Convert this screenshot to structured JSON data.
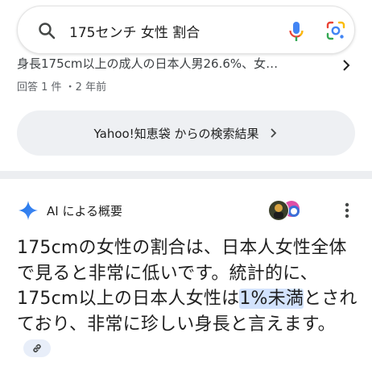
{
  "search": {
    "query": "175センチ 女性 割合"
  },
  "previous_result": {
    "clipped_snippet": "身長175cm以上の成人の日本人男26.6%、女…",
    "meta": "回答 1 件 ・2 年前"
  },
  "more_results": {
    "label": "Yahoo!知恵袋 からの検索結果"
  },
  "ai_overview": {
    "title": "AI による概要",
    "answer_before": "175cmの女性の割合は、日本人女性全体で見ると非常に低いです。統計的に、175cm以上の日本人女性は",
    "answer_highlight": "1%未満",
    "answer_after": "とされており、非常に珍しい身長と言えます。"
  },
  "colors": {
    "highlight": "#d3e3fd",
    "chip_bg": "#eef0f3",
    "google_blue": "#4285f4",
    "google_red": "#ea4335",
    "google_yellow": "#fbbc04",
    "google_green": "#34a853"
  },
  "icons": [
    "search-icon",
    "mic-icon",
    "google-lens-icon",
    "chevron-right-icon",
    "gemini-sparkle-icon",
    "source-avatars-icon",
    "more-vert-icon",
    "link-icon"
  ]
}
